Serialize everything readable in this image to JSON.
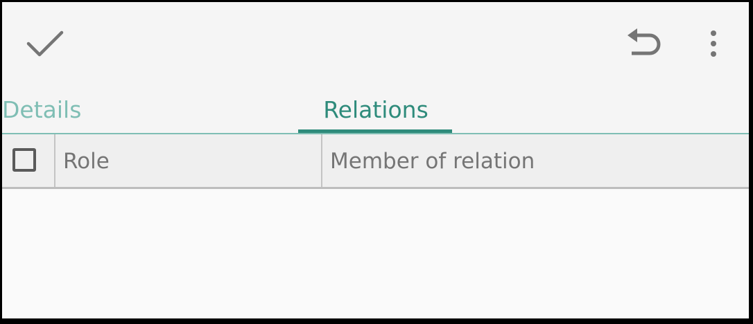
{
  "toolbar": {
    "icons": [
      "check-icon",
      "undo-icon",
      "more-vertical-icon"
    ]
  },
  "tabs": [
    {
      "label": "Details",
      "selected": false
    },
    {
      "label": "Relations",
      "selected": true
    }
  ],
  "table": {
    "columns": [
      {
        "label": "Role"
      },
      {
        "label": "Member of relation"
      }
    ],
    "select_all_checked": false,
    "rows": []
  },
  "colors": {
    "accent": "#2e8b7b",
    "accent_light": "#7fbeb4",
    "icon": "#757575",
    "background": "#f5f5f5"
  }
}
